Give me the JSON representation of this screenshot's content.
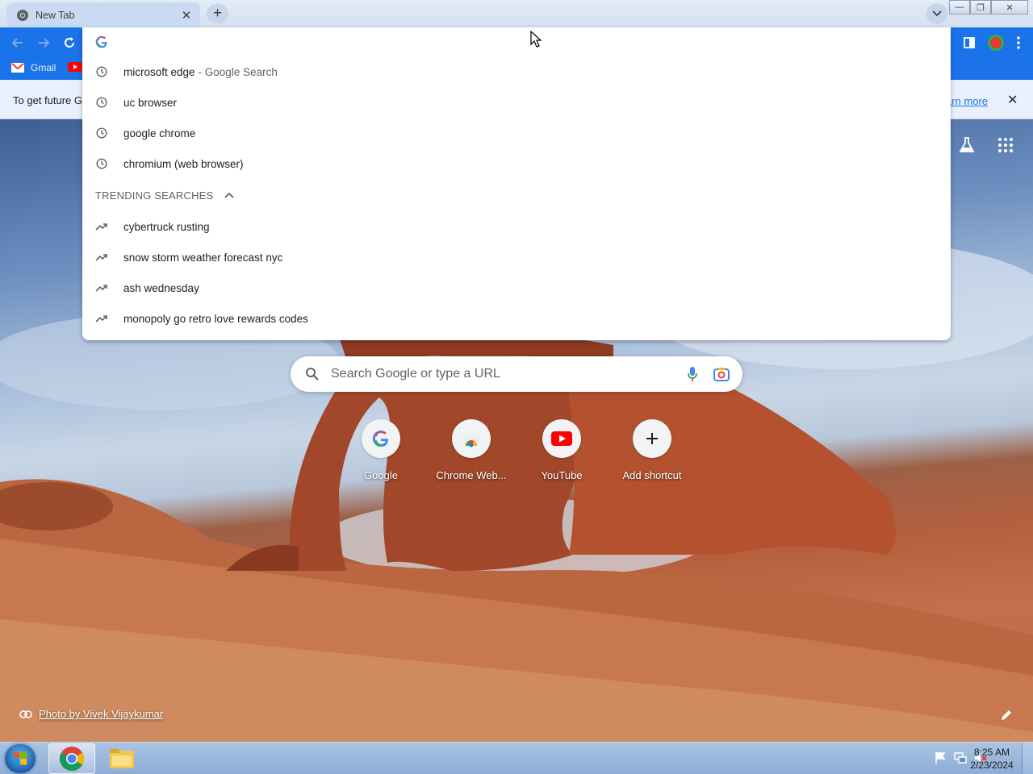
{
  "browser": {
    "tab": {
      "title": "New Tab"
    },
    "bookmarks": [
      {
        "label": "Gmail"
      }
    ],
    "infobar": {
      "message": "To get future G",
      "link": "arn more"
    }
  },
  "omnibox": {
    "history": [
      {
        "text": "microsoft edge",
        "desc": "- Google Search"
      },
      {
        "text": "uc browser",
        "desc": ""
      },
      {
        "text": "google chrome",
        "desc": ""
      },
      {
        "text": "chromium (web browser)",
        "desc": ""
      }
    ],
    "trending_header": "TRENDING SEARCHES",
    "trending": [
      {
        "text": "cybertruck rusting"
      },
      {
        "text": "snow storm weather forecast nyc"
      },
      {
        "text": "ash wednesday"
      },
      {
        "text": "monopoly go retro love rewards codes"
      }
    ]
  },
  "ntp": {
    "search_placeholder": "Search Google or type a URL",
    "shortcuts": [
      {
        "label": "Google"
      },
      {
        "label": "Chrome Web..."
      },
      {
        "label": "YouTube"
      },
      {
        "label": "Add shortcut"
      }
    ],
    "attribution": "Photo by Vivek Vijaykumar"
  },
  "taskbar": {
    "time": "8:25 AM",
    "date": "2/23/2024"
  },
  "colors": {
    "accent": "#1a73e8",
    "infobar": "#e8f0fe",
    "youtube_red": "#ff0000"
  }
}
